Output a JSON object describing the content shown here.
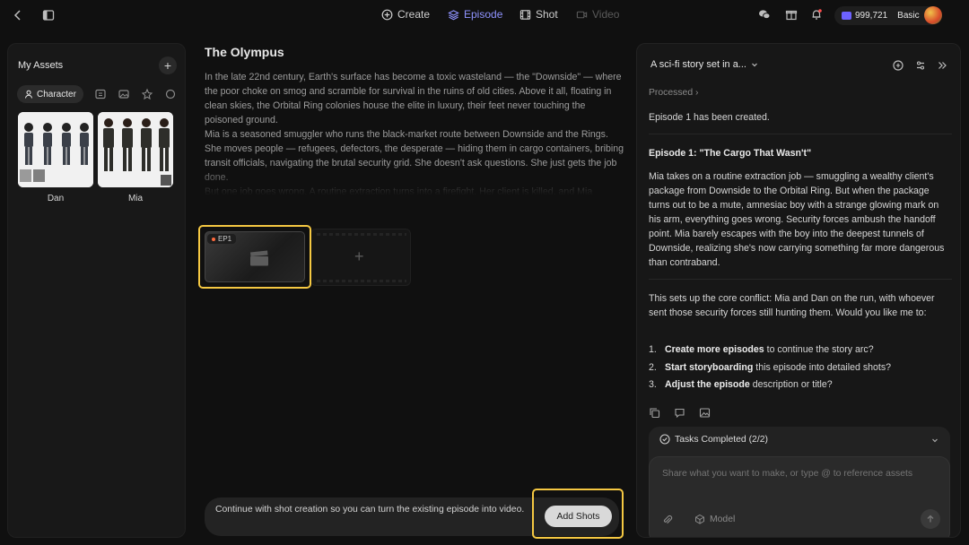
{
  "topbar": {
    "nav": [
      {
        "label": "Create",
        "icon": "plus-circle-icon"
      },
      {
        "label": "Episode",
        "icon": "layers-icon",
        "active": true
      },
      {
        "label": "Shot",
        "icon": "film-icon"
      },
      {
        "label": "Video",
        "icon": "video-icon",
        "disabled": true
      }
    ],
    "credits": "999,721",
    "plan": "Basic",
    "accent": "#8f93ff"
  },
  "assets": {
    "title": "My Assets",
    "filter_active": "Character",
    "items": [
      {
        "name": "Dan"
      },
      {
        "name": "Mia"
      }
    ]
  },
  "story": {
    "title": "The Olympus",
    "paragraphs": [
      "In the late 22nd century, Earth's surface has become a toxic wasteland — the \"Downside\" — where the poor choke on smog and scramble for survival in the ruins of old cities. Above it all, floating in clean skies, the Orbital Ring colonies house the elite in luxury, their feet never touching the poisoned ground.",
      "Mia is a seasoned smuggler who runs the black-market route between Downside and the Rings. She moves people — refugees, defectors, the desperate — hiding them in cargo containers, bribing transit officials, navigating the brutal security grid. She doesn't ask questions. She just gets the job done.",
      "But one job goes wrong. A routine extraction turns into a firefight. Her client is killed, and Mia"
    ]
  },
  "episodes": [
    {
      "badge": "EP1"
    }
  ],
  "suggestion": {
    "text": "Continue with shot creation so you can turn the existing episode into video.",
    "button": "Add Shots"
  },
  "chat": {
    "header": "A sci-fi story set in a...",
    "processed": "Processed",
    "created_msg": "Episode 1 has been created.",
    "episode_heading": "Episode 1: \"The Cargo That Wasn't\"",
    "episode_body": "Mia takes on a routine extraction job — smuggling a wealthy client's package from Downside to the Orbital Ring. But when the package turns out to be a mute, amnesiac boy with a strange glowing mark on his arm, everything goes wrong. Security forces ambush the handoff point. Mia barely escapes with the boy into the deepest tunnels of Downside, realizing she's now carrying something far more dangerous than contraband.",
    "followup": "This sets up the core conflict: Mia and Dan on the run, with whoever sent those security forces still hunting them. Would you like me to:",
    "options": [
      {
        "num": "1.",
        "bold": "Create more episodes",
        "rest": " to continue the story arc?"
      },
      {
        "num": "2.",
        "bold": "Start storyboarding",
        "rest": " this episode into detailed shots?"
      },
      {
        "num": "3.",
        "bold": "Adjust the episode",
        "rest": " description or title?"
      }
    ],
    "tasks": "Tasks Completed (2/2)",
    "placeholder": "Share what you want to make, or type @ to reference assets",
    "model_label": "Model"
  }
}
